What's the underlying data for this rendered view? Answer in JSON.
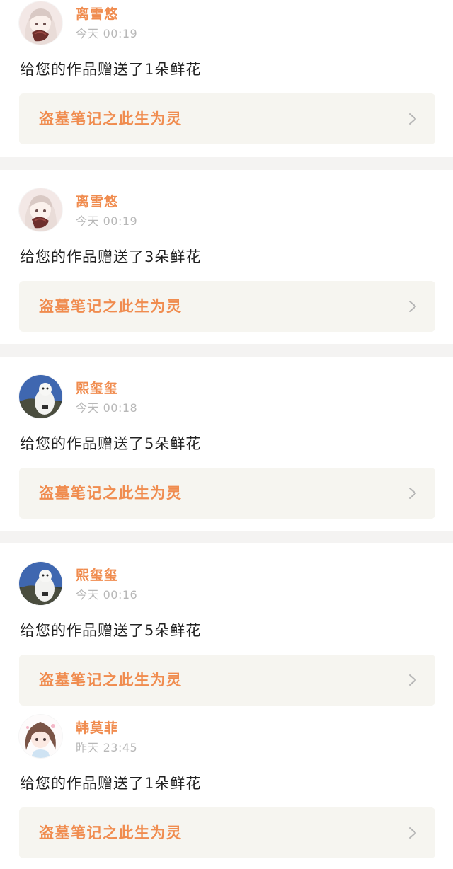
{
  "notifications": [
    {
      "username": "离雪悠",
      "time": "今天 00:19",
      "message": "给您的作品赠送了1朵鲜花",
      "work_title": "盗墓笔记之此生为灵",
      "avatar_icon": "anime-girl-avatar"
    },
    {
      "username": "离雪悠",
      "time": "今天 00:19",
      "message": "给您的作品赠送了3朵鲜花",
      "work_title": "盗墓笔记之此生为灵",
      "avatar_icon": "anime-girl-avatar"
    },
    {
      "username": "熙玺玺",
      "time": "今天 00:18",
      "message": "给您的作品赠送了5朵鲜花",
      "work_title": "盗墓笔记之此生为灵",
      "avatar_icon": "white-dog-avatar"
    },
    {
      "username": "熙玺玺",
      "time": "今天 00:16",
      "message": "给您的作品赠送了5朵鲜花",
      "work_title": "盗墓笔记之此生为灵",
      "avatar_icon": "white-dog-avatar"
    },
    {
      "username": "韩莫菲",
      "time": "昨天 23:45",
      "message": "给您的作品赠送了1朵鲜花",
      "work_title": "盗墓笔记之此生为灵",
      "avatar_icon": "chibi-girl-avatar"
    }
  ],
  "colors": {
    "accent": "#f08c4f",
    "link_background": "#f6f5f0",
    "divider": "#f4f3f2",
    "time_text": "#b8b8b8",
    "message_text": "#222222"
  }
}
